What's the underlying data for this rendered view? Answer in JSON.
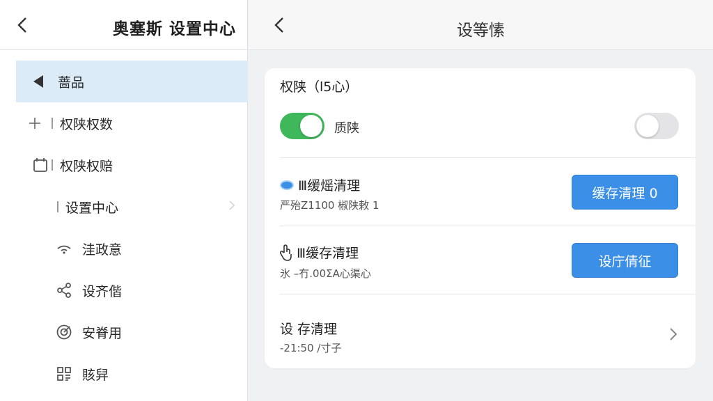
{
  "left": {
    "title": "奥塞斯 设置中心",
    "nav": [
      {
        "label": "蔷品",
        "icon": "triangle-left-icon",
        "active": true
      },
      {
        "label": "权陕权数",
        "icon": "plus-icon"
      },
      {
        "label": "权陕权赔",
        "icon": "calendar-icon"
      },
      {
        "label": "设置中心",
        "icon": "none"
      },
      {
        "label": "洼政意",
        "icon": "wifi-icon"
      },
      {
        "label": "设齐偕",
        "icon": "share-icon"
      },
      {
        "label": "安脊用",
        "icon": "target-icon"
      },
      {
        "label": "賅舁",
        "icon": "grid-icon"
      }
    ]
  },
  "right": {
    "title": "设等愫",
    "section_title": "权陕（l5心）",
    "toggle_label": "质陕",
    "toggle_on": true,
    "toggle2_on": false,
    "row1": {
      "title": "Ⅲ缓熎清理",
      "sub": "严殆Z1100  椒陕敕 1",
      "button": "缓存清理 0"
    },
    "row2": {
      "title": "Ⅲ缓存清理",
      "sub": "氷 –冇.00ΣA心渠心",
      "button": "设庁倩征"
    },
    "row3": {
      "title": "设 存清理",
      "sub": "-21:50 /寸子"
    }
  },
  "colors": {
    "accent": "#3b8fe6",
    "toggle_on": "#3fb85c",
    "active_bg": "#dcebf8"
  }
}
